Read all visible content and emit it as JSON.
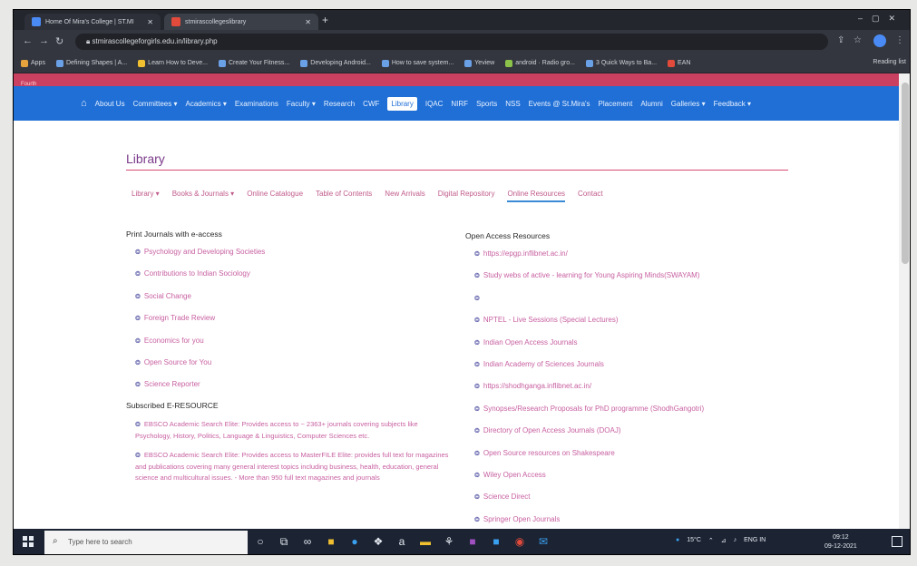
{
  "browser": {
    "tabs": [
      {
        "title": "Home Of Mira's College | ST.MI"
      },
      {
        "title": "stmirascollegeslibrary"
      }
    ],
    "new_tab": "+",
    "url": "stmirascollegeforgirls.edu.in/library.php",
    "bookmarks": [
      "Apps",
      "Defining Shapes | A...",
      "Learn How to Deve...",
      "Create Your Fitness...",
      "Developing Android...",
      "How to save system...",
      "Yeview",
      "android · Radio gro...",
      "3 Quick Ways to Ba...",
      "EAN"
    ],
    "reading_list": "Reading list"
  },
  "site": {
    "top_band_text": "Fourth",
    "nav": [
      "About Us",
      "Committees ▾",
      "Academics ▾",
      "Examinations",
      "Faculty ▾",
      "Research",
      "CWF",
      "Library",
      "IQAC",
      "NIRF",
      "Sports",
      "NSS",
      "Events @ St.Mira's",
      "Placement",
      "Alumni",
      "Galleries ▾",
      "Feedback ▾"
    ],
    "active_nav": "Library",
    "page_title": "Library",
    "subnav": [
      "Library ▾",
      "Books & Journals ▾",
      "Online Catalogue",
      "Table of Contents",
      "New Arrivals",
      "Digital Repository",
      "Online Resources",
      "Contact"
    ],
    "subnav_selected": "Online Resources"
  },
  "left_column": {
    "heading1": "Print Journals with e-access",
    "print_journals": [
      "Psychology and Developing Societies",
      "Contributions to Indian Sociology",
      "Social Change",
      "Foreign Trade Review",
      "Economics for you",
      "Open Source for You",
      "Science Reporter"
    ],
    "heading2": "Subscribed E-RESOURCE",
    "eresources": [
      "EBSCO Academic Search Elite: Provides access to ~ 2363+ journals covering subjects like Psychology, History, Politics, Language & Linguistics, Computer Sciences etc.",
      "EBSCO Academic Search Elite: Provides access to MasterFILE Elite: provides full text for magazines and publications covering many general interest topics including business, health, education, general science and multicultural issues. - More than 950 full text magazines and journals"
    ]
  },
  "right_column": {
    "heading": "Open Access Resources",
    "items": [
      "https://epgp.inflibnet.ac.in/",
      "Study webs of active - learning for Young Aspiring Minds(SWAYAM)",
      "",
      "NPTEL - Live Sessions (Special Lectures)",
      "Indian Open Access Journals",
      "Indian Academy of Sciences Journals",
      "https://shodhganga.inflibnet.ac.in/",
      "Synopses/Research Proposals for PhD programme (ShodhGangotri)",
      "Directory of Open Access Journals (DOAJ)",
      "Open Source resources on Shakespeare",
      "Wiley Open Access",
      "Science Direct",
      "Springer Open Journals"
    ]
  },
  "taskbar": {
    "search_placeholder": "Type here to search",
    "weather": "15°C",
    "lang": "ENG IN",
    "time": "09:12",
    "date": "09-12-2021"
  }
}
